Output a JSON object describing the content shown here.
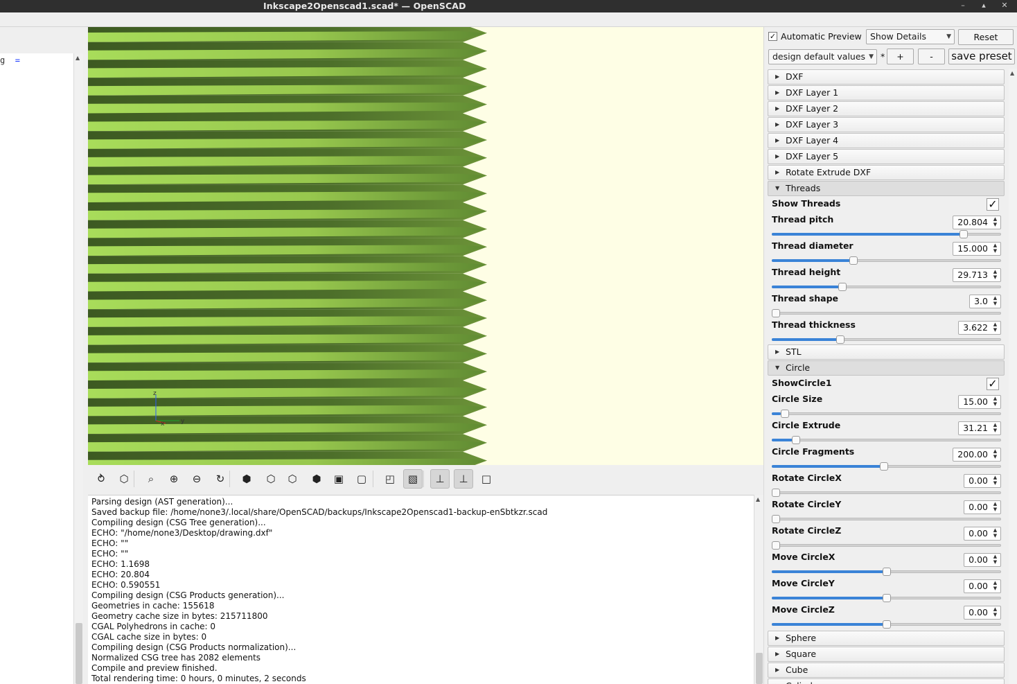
{
  "window": {
    "title": "Inkscape2Openscad1.scad* — OpenSCAD",
    "minimize": "–",
    "maximize": "▴",
    "close": "✕"
  },
  "editor": {
    "code_line": "g",
    "code_op": "="
  },
  "viewport": {
    "axis_z": "z",
    "axis_y": "y",
    "axis_x": "x",
    "part_color_light": "#a8dc5a",
    "part_color_dark": "#3d5a22",
    "background": "#fefee5"
  },
  "toolbar": {
    "buttons": [
      {
        "name": "preview-icon",
        "glyph": "⥁"
      },
      {
        "name": "render-icon",
        "glyph": "⬡"
      },
      {
        "name": "view-all-icon",
        "glyph": "⌕"
      },
      {
        "name": "zoom-in-icon",
        "glyph": "⊕"
      },
      {
        "name": "zoom-out-icon",
        "glyph": "⊖"
      },
      {
        "name": "reset-view-icon",
        "glyph": "↻"
      },
      {
        "name": "view-right-icon",
        "glyph": "⬢"
      },
      {
        "name": "view-top-icon",
        "glyph": "⬡"
      },
      {
        "name": "view-bottom-icon",
        "glyph": "⬡"
      },
      {
        "name": "view-left-icon",
        "glyph": "⬢"
      },
      {
        "name": "view-front-icon",
        "glyph": "▣"
      },
      {
        "name": "view-back-icon",
        "glyph": "▢"
      },
      {
        "name": "perspective-icon",
        "glyph": "◰"
      },
      {
        "name": "orthogonal-icon",
        "glyph": "▧"
      },
      {
        "name": "show-axes-icon",
        "glyph": "⊥"
      },
      {
        "name": "show-scale-icon",
        "glyph": "⊥"
      },
      {
        "name": "show-edges-icon",
        "glyph": "□"
      }
    ]
  },
  "console": {
    "lines": [
      "Parsing design (AST generation)...",
      "Saved backup file: /home/none3/.local/share/OpenSCAD/backups/Inkscape2Openscad1-backup-enSbtkzr.scad",
      "Compiling design (CSG Tree generation)...",
      "ECHO: \"/home/none3/Desktop/drawing.dxf\"",
      "ECHO: \"\"",
      "ECHO: \"\"",
      "ECHO: 1.1698",
      "ECHO: 20.804",
      "ECHO: 0.590551",
      "Compiling design (CSG Products generation)...",
      "Geometries in cache: 155618",
      "Geometry cache size in bytes: 215711800",
      "CGAL Polyhedrons in cache: 0",
      "CGAL cache size in bytes: 0",
      "Compiling design (CSG Products normalization)...",
      "Normalized CSG tree has 2082 elements",
      "Compile and preview finished.",
      "Total rendering time: 0 hours, 0 minutes, 2 seconds"
    ]
  },
  "customizer": {
    "auto_preview_label": "Automatic Preview",
    "auto_preview_checked": "✓",
    "details_select": "Show Details",
    "reset_label": "Reset",
    "preset_select": "design default values",
    "preset_modified": "*",
    "add_preset": "+",
    "remove_preset": "-",
    "save_preset": "save preset",
    "groups_top": [
      {
        "label": "DXF"
      },
      {
        "label": "DXF Layer 1"
      },
      {
        "label": "DXF Layer 2"
      },
      {
        "label": "DXF Layer 3"
      },
      {
        "label": "DXF Layer 4"
      },
      {
        "label": "DXF Layer 5"
      },
      {
        "label": "Rotate Extrude DXF"
      }
    ],
    "threads": {
      "label": "Threads",
      "show_label": "Show Threads",
      "show_checked": "✓",
      "params": [
        {
          "label": "Thread pitch",
          "value": "20.804",
          "fill": 0.85
        },
        {
          "label": "Thread diameter",
          "value": "15.000",
          "fill": 0.35
        },
        {
          "label": "Thread height",
          "value": "29.713",
          "fill": 0.3
        },
        {
          "label": "Thread shape",
          "value": "3.0",
          "fill": 0.0
        },
        {
          "label": "Thread thickness",
          "value": "3.622",
          "fill": 0.29
        }
      ]
    },
    "stl_label": "STL",
    "circle": {
      "label": "Circle",
      "show_label": "ShowCircle1",
      "show_checked": "✓",
      "params": [
        {
          "label": "Circle Size",
          "value": "15.00",
          "fill": 0.04
        },
        {
          "label": "Circle Extrude",
          "value": "31.21",
          "fill": 0.09
        },
        {
          "label": "Circle Fragments",
          "value": "200.00",
          "fill": 0.49
        },
        {
          "label": "Rotate CircleX",
          "value": "0.00",
          "fill": 0.0
        },
        {
          "label": "Rotate CircleY",
          "value": "0.00",
          "fill": 0.0
        },
        {
          "label": "Rotate CircleZ",
          "value": "0.00",
          "fill": 0.0
        },
        {
          "label": "Move CircleX",
          "value": "0.00",
          "fill": 0.5
        },
        {
          "label": "Move CircleY",
          "value": "0.00",
          "fill": 0.5
        },
        {
          "label": "Move CircleZ",
          "value": "0.00",
          "fill": 0.5
        }
      ]
    },
    "groups_bottom": [
      {
        "label": "Sphere"
      },
      {
        "label": "Square"
      },
      {
        "label": "Cube"
      },
      {
        "label": "Cylinder"
      }
    ]
  }
}
